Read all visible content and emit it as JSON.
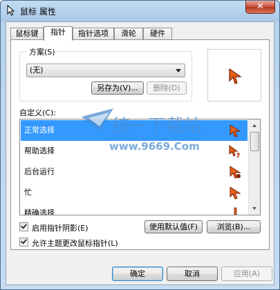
{
  "window": {
    "title": "鼠标 属性",
    "close_glyph": "✕"
  },
  "tabs": [
    "鼠标键",
    "指针",
    "指针选项",
    "滑轮",
    "硬件"
  ],
  "active_tab": "指针",
  "scheme": {
    "group_label": "方案(S)",
    "selected": "(无)",
    "save_as_label": "另存为(V)...",
    "delete_label": "删除(D)"
  },
  "customize": {
    "label": "自定义(C):",
    "items": [
      {
        "label": "正常选择",
        "icon": "arrow-cursor-icon",
        "selected": true
      },
      {
        "label": "帮助选择",
        "icon": "help-cursor-icon",
        "selected": false
      },
      {
        "label": "后台运行",
        "icon": "busy-arrow-cursor-icon",
        "selected": false
      },
      {
        "label": "忙",
        "icon": "busy-cursor-icon",
        "selected": false
      },
      {
        "label": "精确选择",
        "icon": "precision-cursor-icon",
        "selected": false
      }
    ]
  },
  "options": {
    "shadow_label": "启用指针阴影(E)",
    "shadow_checked": true,
    "use_default_label": "使用默认值(F)",
    "browse_label": "浏览(B)...",
    "theme_label": "允许主题更改鼠标指针(L)",
    "theme_checked": true
  },
  "buttons": {
    "ok": "确定",
    "cancel": "取消",
    "apply": "应用(A)"
  },
  "watermark": {
    "line1": "统一下载站",
    "line2": "www.9669.Com"
  },
  "colors": {
    "selection": "#3399ff",
    "cursor_fill": "#e2621b",
    "cursor_outline": "#7a1f05"
  }
}
